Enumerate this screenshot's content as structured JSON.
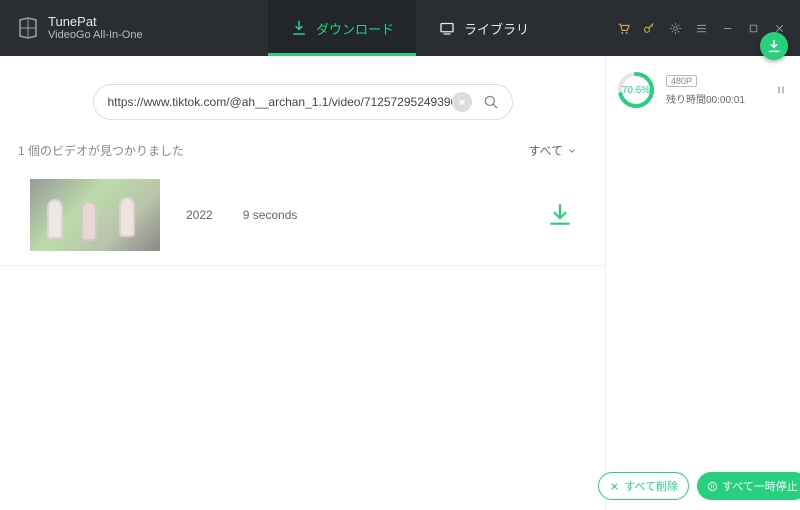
{
  "brand": {
    "name": "TunePat",
    "subtitle": "VideoGo All-In-One"
  },
  "nav": {
    "download": "ダウンロード",
    "library": "ライブラリ"
  },
  "search": {
    "value": "https://www.tiktok.com/@ah__archan_1.1/video/71257295249390"
  },
  "results": {
    "count_text": "1 個のビデオが見つかりました",
    "all_label": "すべて",
    "items": [
      {
        "year": "2022",
        "duration": "9 seconds"
      }
    ]
  },
  "task": {
    "percent_text": "70.6%",
    "percent_value": 70.6,
    "quality": "480P",
    "remaining_label": "残り時間",
    "remaining_value": "00:00:01"
  },
  "actions": {
    "delete_all": "すべて削除",
    "pause_all": "すべて一時停止"
  }
}
